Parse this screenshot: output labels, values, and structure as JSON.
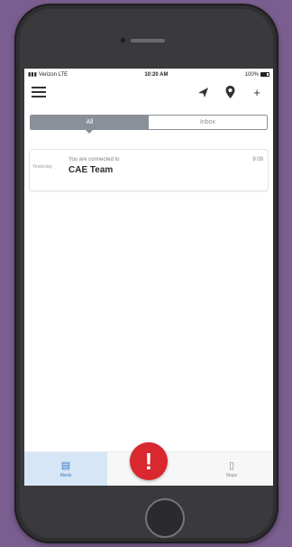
{
  "statusbar": {
    "carrier": "Verizon LTE",
    "time": "10:20 AM",
    "battery": "100%"
  },
  "appbar": {
    "icons": [
      "hamburger-icon",
      "send-icon",
      "map-pin-icon",
      "plus-icon"
    ],
    "plus_label": "+"
  },
  "segment": {
    "left_label": "All",
    "right_label": "Inbox"
  },
  "message": {
    "label": "Yesterday",
    "subtitle": "You are connected to",
    "title": "CAE Team",
    "time": "9:09"
  },
  "tabbar": {
    "tabs": [
      {
        "label": "Alerts",
        "icon": "inbox-icon",
        "active": true
      },
      {
        "label": "",
        "icon": "",
        "active": false
      },
      {
        "label": "Maps",
        "icon": "map-icon",
        "active": false
      }
    ]
  },
  "alert_button": {
    "label": "!",
    "color": "#d9282f"
  },
  "colors": {
    "background": "#7a5e8f",
    "phone_body": "#2f2f31",
    "segment_active": "#8a9099",
    "tab_active_bg": "#d6e6f6"
  }
}
